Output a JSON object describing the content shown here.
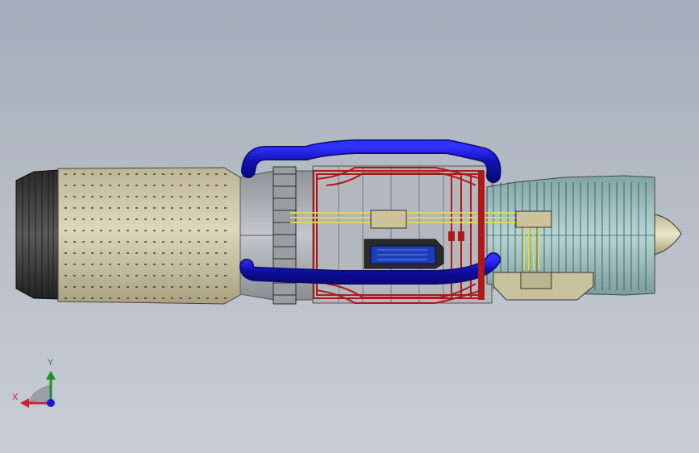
{
  "viewport": {
    "background_top": "#a3acb8",
    "background_bottom": "#c8ced7"
  },
  "model": {
    "parts": [
      {
        "name": "exhaust-nozzle",
        "color": "#3a3a3a"
      },
      {
        "name": "perforated-casing",
        "color": "#cfc7a8"
      },
      {
        "name": "turbine-section",
        "color": "#a8adb2"
      },
      {
        "name": "flange-ring",
        "color": "#8c8f93"
      },
      {
        "name": "combustion-frame",
        "color": "#b01818"
      },
      {
        "name": "fuel-manifold-pipes",
        "color": "#1414c8"
      },
      {
        "name": "wiring-harness",
        "color": "#e0d84a"
      },
      {
        "name": "control-unit",
        "color": "#cdc39a"
      },
      {
        "name": "accessory-gearbox",
        "color": "#c9c19c"
      },
      {
        "name": "compressor-housing",
        "color": "#9ec4c4"
      },
      {
        "name": "inlet-spinner",
        "color": "#d6cfad"
      }
    ]
  },
  "triad": {
    "x_label": "X",
    "y_label": "Y",
    "x_color": "#d0202a",
    "y_color": "#1b8f2a",
    "z_color": "#1a1ad0"
  }
}
